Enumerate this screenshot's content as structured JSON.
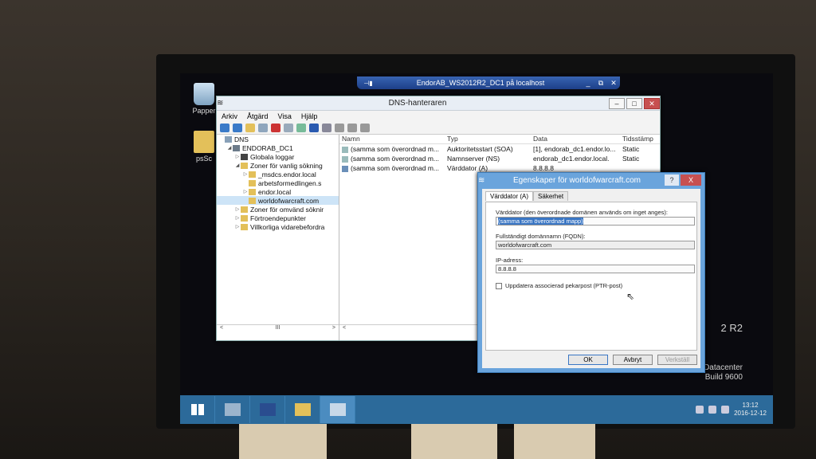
{
  "rdp": {
    "title": "EndorAB_WS2012R2_DC1 på localhost",
    "controls": [
      "_",
      "⧉",
      "✕"
    ]
  },
  "desktop": {
    "icons": [
      {
        "label": "Papper"
      },
      {
        "label": "psSc"
      }
    ],
    "watermark_edition": "2 R2",
    "watermark_product": "Windows Server 2012 R2 Datacenter",
    "watermark_build": "Build 9600"
  },
  "dns_window": {
    "title": "DNS-hanteraren",
    "menu": [
      "Arkiv",
      "Åtgärd",
      "Visa",
      "Hjälp"
    ],
    "tree": [
      {
        "label": "DNS",
        "depth": 0,
        "icon": "dns-icon"
      },
      {
        "label": "ENDORAB_DC1",
        "depth": 1,
        "icon": "server-icon"
      },
      {
        "label": "Globala loggar",
        "depth": 2,
        "icon": "log-icon"
      },
      {
        "label": "Zoner för vanlig sökning",
        "depth": 2,
        "icon": "folder-icon",
        "expanded": true
      },
      {
        "label": "_msdcs.endor.local",
        "depth": 3,
        "icon": "folder-icon"
      },
      {
        "label": "arbetsformedlingen.s",
        "depth": 3,
        "icon": "folder-icon"
      },
      {
        "label": "endor.local",
        "depth": 3,
        "icon": "folder-icon"
      },
      {
        "label": "worldofwarcraft.com",
        "depth": 3,
        "icon": "folder-icon",
        "selected": true
      },
      {
        "label": "Zoner för omvänd söknir",
        "depth": 2,
        "icon": "folder-icon"
      },
      {
        "label": "Förtroendepunkter",
        "depth": 2,
        "icon": "folder-icon"
      },
      {
        "label": "Villkorliga vidarebefordra",
        "depth": 2,
        "icon": "folder-icon"
      }
    ],
    "columns": [
      "Namn",
      "Typ",
      "Data",
      "Tidsstämp"
    ],
    "records": [
      {
        "name": "(samma som överordnad m...",
        "type": "Auktoritetsstart (SOA)",
        "data": "[1], endorab_dc1.endor.lo...",
        "ts": "Static"
      },
      {
        "name": "(samma som överordnad m...",
        "type": "Namnserver (NS)",
        "data": "endorab_dc1.endor.local.",
        "ts": "Static"
      },
      {
        "name": "(samma som överordnad m...",
        "type": "Värddator (A)",
        "data": "8.8.8.8",
        "ts": ""
      }
    ],
    "scroll_mark": "III"
  },
  "dialog": {
    "title": "Egenskaper för worldofwarcraft.com",
    "help": "?",
    "close": "X",
    "tabs": [
      "Värddator (A)",
      "Säkerhet"
    ],
    "host_label": "Värddator (den överordnade domänen används om inget anges):",
    "host_value": "(samma som överordnad mapp)",
    "fqdn_label": "Fullständigt domännamn (FQDN):",
    "fqdn_value": "worldofwarcraft.com",
    "ip_label": "IP-adress:",
    "ip_value": "8.8.8.8",
    "ptr_label": "Uppdatera associerad pekarpost (PTR-post)",
    "ok": "OK",
    "cancel": "Avbryt",
    "apply": "Verkställ"
  },
  "taskbar": {
    "clock_time": "13:12",
    "clock_date": "2016-12-12"
  },
  "colors": {
    "taskbar": "#2c6a9a",
    "dialog_frame": "#6aa4dc",
    "selection": "#3a76c4"
  }
}
